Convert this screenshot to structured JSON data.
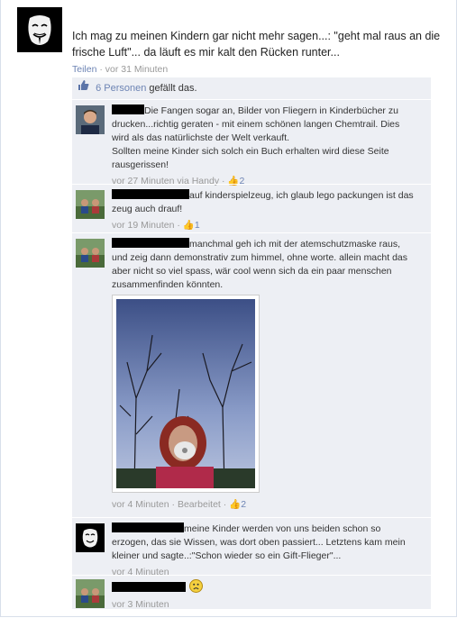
{
  "post": {
    "text": "Ich mag zu meinen Kindern gar nicht mehr sagen...: \"geht mal raus an die frische Luft\"... da läuft es mir kalt den Rücken runter...",
    "share_label": "Teilen",
    "separator": " · ",
    "time": "vor 31 Minuten"
  },
  "likes": {
    "count_label": "6 Personen",
    "suffix": " gefällt das."
  },
  "comments": [
    {
      "text": "Die Fangen sogar an, Bilder von Fliegern in Kinderbücher zu drucken...richtig geraten - mit einem schönen langen Chemtrail. Dies wird als das natürlichste der Welt verkauft.",
      "text2": "Sollten meine Kinder sich solch ein Buch erhalten wird diese Seite rausgerissen!",
      "time": "vor 27 Minuten via Handy",
      "likes": "2"
    },
    {
      "text": "auf kinderspielzeug, ich glaub lego packungen ist das zeug auch drauf!",
      "time": "vor 19 Minuten",
      "likes": "1"
    },
    {
      "text": "manchmal geh ich mit der atemschutzmaske raus, und zeig dann demonstrativ zum himmel, ohne worte. allein macht das aber nicht so viel spass, wär cool wenn sich da ein paar menschen zusammenfinden könnten.",
      "time": "vor 4 Minuten",
      "edited": "Bearbeitet",
      "likes": "2"
    },
    {
      "text": "meine Kinder werden von uns beiden schon so erzogen, das sie Wissen, was dort oben passiert... Letztens kam mein kleiner und sagte..:\"Schon wieder so ein Gift-Flieger\"...",
      "time": "vor 4 Minuten"
    },
    {
      "text": "",
      "time": "vor 3 Minuten"
    }
  ],
  "icons": {
    "like": "thumbs-up-icon",
    "smiley": "frown-smiley-icon"
  },
  "colors": {
    "link": "#6d84b4",
    "feedback_bg": "#edeff4",
    "redaction": "#000000"
  }
}
